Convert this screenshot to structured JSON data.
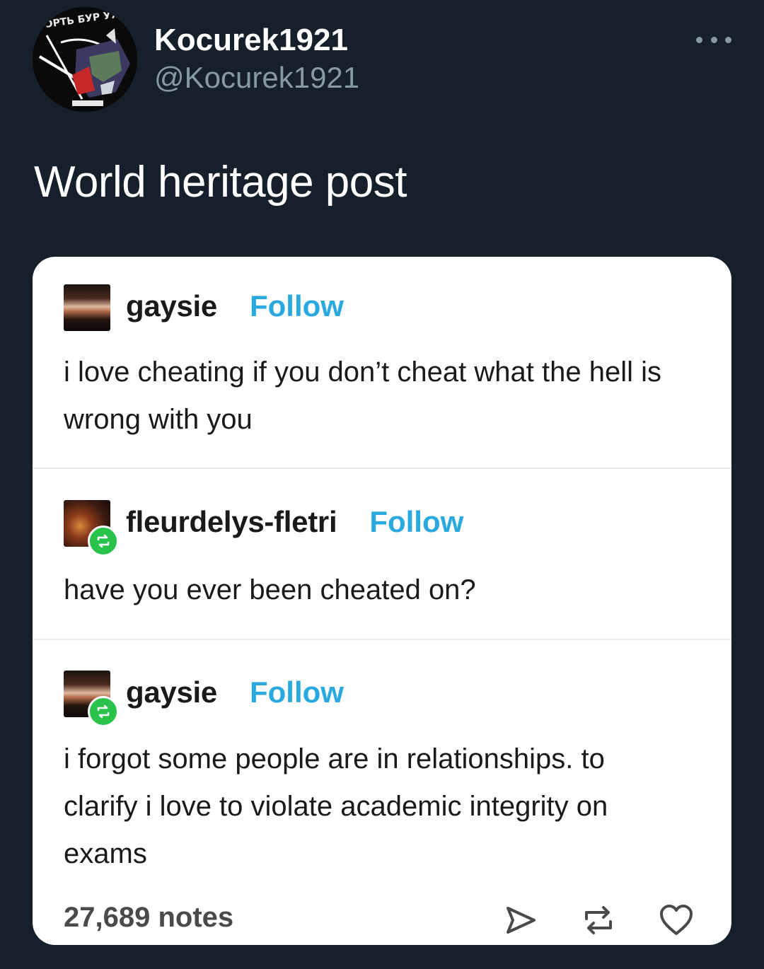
{
  "tweet": {
    "avatar_text": "ꓛꓑꓔЬ БУР УЯМЬ",
    "display_name": "Kocurek1921",
    "handle": "@Kocurek1921",
    "text": "World heritage post"
  },
  "tumblr": {
    "posts": [
      {
        "blog": "gaysie",
        "follow": "Follow",
        "body": "i love cheating if you don’t cheat what the hell is wrong with you",
        "reblog": false
      },
      {
        "blog": "fleurdelys-fletri",
        "follow": "Follow",
        "body": "have you ever been cheated on?",
        "reblog": true
      },
      {
        "blog": "gaysie",
        "follow": "Follow",
        "body": "i forgot some people are in relationships. to clarify i love to violate academic integrity on exams",
        "reblog": true
      }
    ],
    "notes": "27,689 notes"
  },
  "icons": [
    "more-icon",
    "share-icon",
    "reblog-icon",
    "like-icon",
    "reblog-badge-icon"
  ],
  "colors": {
    "background": "#15202b",
    "card": "#ffffff",
    "follow": "#2aa9e0",
    "reblog_badge": "#29c24a",
    "handle": "#8899a6"
  }
}
